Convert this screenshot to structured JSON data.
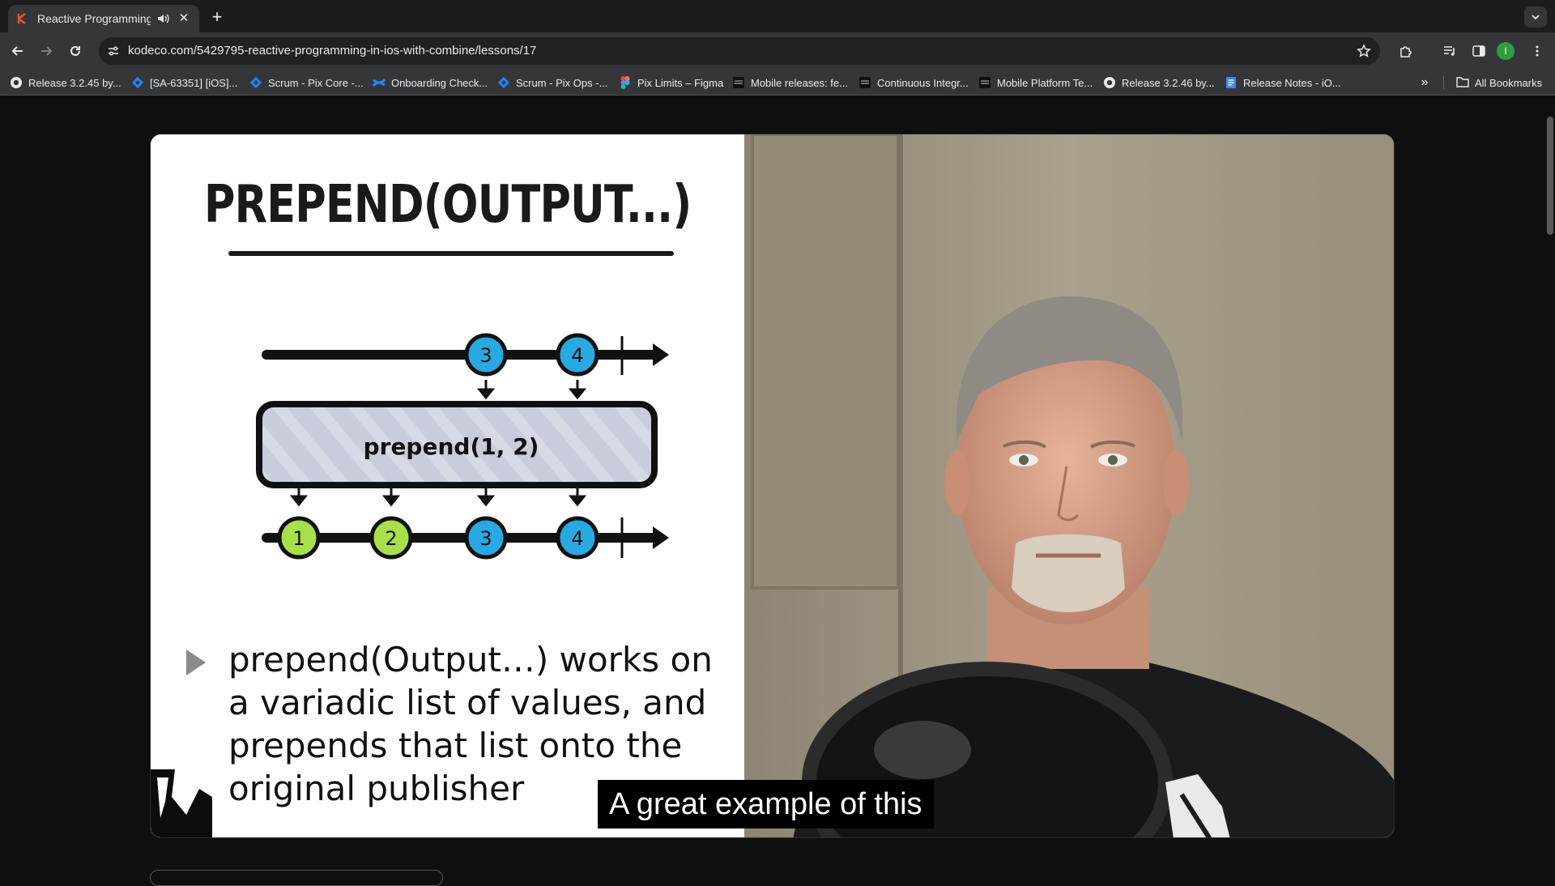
{
  "browser": {
    "tab": {
      "title": "Reactive Programming in",
      "favicon": "kodeco-k-icon",
      "audio_icon": "speaker-icon"
    },
    "address_bar": {
      "url": "kodeco.com/5429795-reactive-programming-in-ios-with-combine/lessons/17"
    },
    "profile_initial": "I",
    "bookmarks": [
      {
        "icon": "github-icon",
        "label": "Release 3.2.45 by..."
      },
      {
        "icon": "jira-icon",
        "label": "[SA-63351] [iOS]..."
      },
      {
        "icon": "jira-icon",
        "label": "Scrum - Pix Core -..."
      },
      {
        "icon": "confluence-icon",
        "label": "Onboarding Check..."
      },
      {
        "icon": "jira-icon",
        "label": "Scrum - Pix Ops -..."
      },
      {
        "icon": "figma-icon",
        "label": "Pix Limits – Figma"
      },
      {
        "icon": "app-icon",
        "label": "Mobile releases: fe..."
      },
      {
        "icon": "app-icon",
        "label": "Continuous Integr..."
      },
      {
        "icon": "app-icon",
        "label": "Mobile Platform Te..."
      },
      {
        "icon": "github-icon",
        "label": "Release 3.2.46 by..."
      },
      {
        "icon": "docs-icon",
        "label": "Release Notes - iO..."
      }
    ],
    "all_bookmarks_label": "All Bookmarks"
  },
  "video": {
    "slide": {
      "title": "PREPEND(OUTPUT...)",
      "diagram": {
        "top_values": [
          "3",
          "4"
        ],
        "operator_label": "prepend(1, 2)",
        "bottom_values": [
          "1",
          "2",
          "3",
          "4"
        ],
        "colors": {
          "prepended": "#a8e04a",
          "original": "#29a9e1",
          "operator_fill": "#c9ccdd"
        }
      },
      "bullet": "prepend(Output…) works on a variadic list of values, and prepends that list onto the original publisher"
    },
    "caption": "A great example of this"
  }
}
